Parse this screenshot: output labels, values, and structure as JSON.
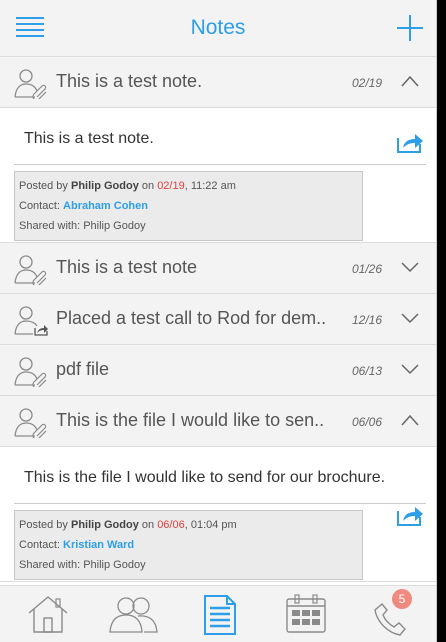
{
  "header": {
    "title": "Notes"
  },
  "notes": [
    {
      "title": "This is a test note.",
      "date": "02/19",
      "body": "This is a test note.",
      "posted_prefix": "Posted by ",
      "posted_by": "Philip Godoy",
      "on": " on ",
      "posted_date": "02/19",
      "posted_time": ", 11:22 am",
      "contact_label": "Contact: ",
      "contact": "Abraham Cohen",
      "shared": "Shared with: Philip Godoy"
    },
    {
      "title": "This is a test note",
      "date": "01/26"
    },
    {
      "title": "Placed a test call to Rod for dem..",
      "date": "12/16"
    },
    {
      "title": "pdf file",
      "date": "06/13"
    },
    {
      "title": "This is the file I would like to sen..",
      "date": "06/06",
      "body": "This is the file I would like to send for our brochure.",
      "posted_prefix": "Posted by ",
      "posted_by": "Philip Godoy",
      "on": " on ",
      "posted_date": "06/06",
      "posted_time": ", 01:04 pm",
      "contact_label": "Contact: ",
      "contact": "Kristian Ward",
      "shared": "Shared with: Philip Godoy"
    }
  ],
  "tabbar": {
    "items": [
      "home-icon",
      "contacts-icon",
      "notes-icon",
      "calendar-icon",
      "phone-icon"
    ],
    "active": "notes-icon",
    "badge": "5"
  },
  "colors": {
    "accent": "#2d9ee8",
    "date_red": "#e04040",
    "badge": "#f0897f"
  }
}
